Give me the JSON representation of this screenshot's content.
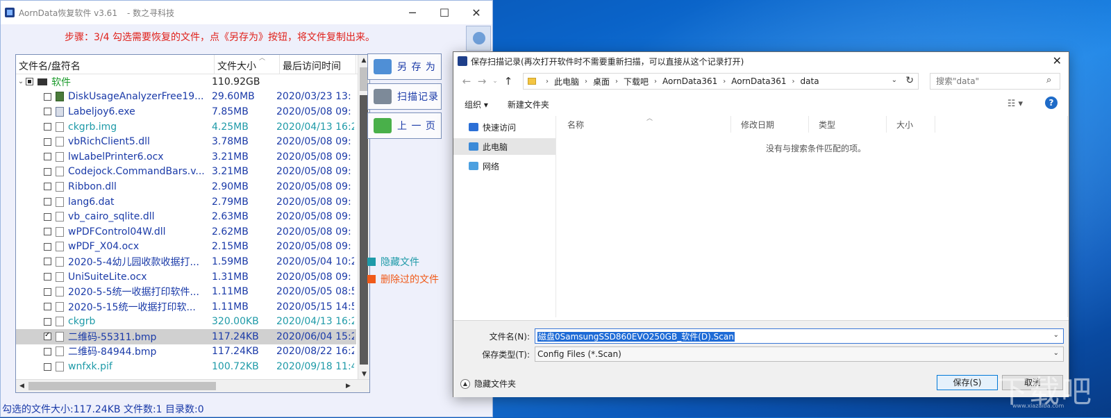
{
  "app": {
    "title": "AornData恢复软件 v3.61",
    "subtitle": "- 数之寻科技",
    "step_text": "步骤：3/4 勾选需要恢复的文件，点《另存为》按钮，将文件复制出来。",
    "columns": {
      "name": "文件名/盘符名",
      "size": "文件大小",
      "date": "最后访问时间"
    },
    "root": {
      "name": "软件",
      "size": "110.92GB"
    },
    "files": [
      {
        "name": "DiskUsageAnalyzerFree19...",
        "size": "29.60MB",
        "date": "2020/03/23 13:",
        "color": "#1a3aa8",
        "icon": "app",
        "checked": false
      },
      {
        "name": "Labeljoy6.exe",
        "size": "7.85MB",
        "date": "2020/05/08 09:",
        "color": "#1a3aa8",
        "icon": "app2",
        "checked": false
      },
      {
        "name": "ckgrb.img",
        "size": "4.25MB",
        "date": "2020/04/13 16:2",
        "color": "#1e9aa8",
        "icon": "file",
        "checked": false
      },
      {
        "name": "vbRichClient5.dll",
        "size": "3.78MB",
        "date": "2020/05/08 09:",
        "color": "#1a3aa8",
        "icon": "file",
        "checked": false
      },
      {
        "name": "lwLabelPrinter6.ocx",
        "size": "3.21MB",
        "date": "2020/05/08 09:",
        "color": "#1a3aa8",
        "icon": "file",
        "checked": false
      },
      {
        "name": "Codejock.CommandBars.v...",
        "size": "3.21MB",
        "date": "2020/05/08 09:",
        "color": "#1a3aa8",
        "icon": "file",
        "checked": false
      },
      {
        "name": "Ribbon.dll",
        "size": "2.90MB",
        "date": "2020/05/08 09:",
        "color": "#1a3aa8",
        "icon": "file",
        "checked": false
      },
      {
        "name": "lang6.dat",
        "size": "2.79MB",
        "date": "2020/05/08 09:",
        "color": "#1a3aa8",
        "icon": "file",
        "checked": false
      },
      {
        "name": "vb_cairo_sqlite.dll",
        "size": "2.63MB",
        "date": "2020/05/08 09:",
        "color": "#1a3aa8",
        "icon": "file",
        "checked": false
      },
      {
        "name": "wPDFControl04W.dll",
        "size": "2.62MB",
        "date": "2020/05/08 09:",
        "color": "#1a3aa8",
        "icon": "file",
        "checked": false
      },
      {
        "name": "wPDF_X04.ocx",
        "size": "2.15MB",
        "date": "2020/05/08 09:",
        "color": "#1a3aa8",
        "icon": "file",
        "checked": false
      },
      {
        "name": "2020-5-4幼儿园收款收据打...",
        "size": "1.59MB",
        "date": "2020/05/04 10:2",
        "color": "#1a3aa8",
        "icon": "file",
        "checked": false
      },
      {
        "name": "UniSuiteLite.ocx",
        "size": "1.31MB",
        "date": "2020/05/08 09:",
        "color": "#1a3aa8",
        "icon": "file",
        "checked": false
      },
      {
        "name": "2020-5-5统一收据打印软件...",
        "size": "1.11MB",
        "date": "2020/05/05 08:5",
        "color": "#1a3aa8",
        "icon": "file",
        "checked": false
      },
      {
        "name": "2020-5-15统一收据打印软...",
        "size": "1.11MB",
        "date": "2020/05/15 14:5",
        "color": "#1a3aa8",
        "icon": "file",
        "checked": false
      },
      {
        "name": "ckgrb",
        "size": "320.00KB",
        "date": "2020/04/13 16:2",
        "color": "#1e9aa8",
        "icon": "file",
        "checked": false
      },
      {
        "name": "二维码-55311.bmp",
        "size": "117.24KB",
        "date": "2020/06/04 15:2",
        "color": "#1a3aa8",
        "icon": "file",
        "checked": true,
        "selected": true
      },
      {
        "name": "二维码-84944.bmp",
        "size": "117.24KB",
        "date": "2020/08/22 16:2",
        "color": "#1a3aa8",
        "icon": "file",
        "checked": false
      },
      {
        "name": "wnfxk.pif",
        "size": "100.72KB",
        "date": "2020/09/18 11:4",
        "color": "#1e9aa8",
        "icon": "file",
        "checked": false
      }
    ],
    "buttons": {
      "save_as": "另 存 为",
      "scan_record": "扫描记录",
      "prev_page": "上 一 页"
    },
    "legend": [
      {
        "label": "隐藏文件",
        "color": "#1e9aa8"
      },
      {
        "label": "删除过的文件",
        "color": "#f05a1a"
      }
    ],
    "status": "勾选的文件大小:117.24KB    文件数:1    目录数:0"
  },
  "dialog": {
    "title": "保存扫描记录(再次打开软件时不需要重新扫描，可以直接从这个记录打开)",
    "breadcrumb": [
      "此电脑",
      "桌面",
      "下载吧",
      "AornData361",
      "AornData361",
      "data"
    ],
    "search_placeholder": "搜索\"data\"",
    "organize": "组织 ▾",
    "new_folder": "新建文件夹",
    "nav": [
      "快速访问",
      "此电脑",
      "网络"
    ],
    "columns": {
      "name": "名称",
      "date": "修改日期",
      "type": "类型",
      "size": "大小"
    },
    "empty_message": "没有与搜索条件匹配的项。",
    "filename_label": "文件名(N):",
    "filename_value": "磁盘0SamsungSSD860EVO250GB_软件(D).Scan",
    "filetype_label": "保存类型(T):",
    "filetype_value": "Config Files (*.Scan)",
    "hide_folders": "隐藏文件夹",
    "save_button": "保存(S)",
    "cancel_button": "取消"
  },
  "watermark": {
    "big": "下载吧",
    "small": "www.xiazaiba.com"
  }
}
